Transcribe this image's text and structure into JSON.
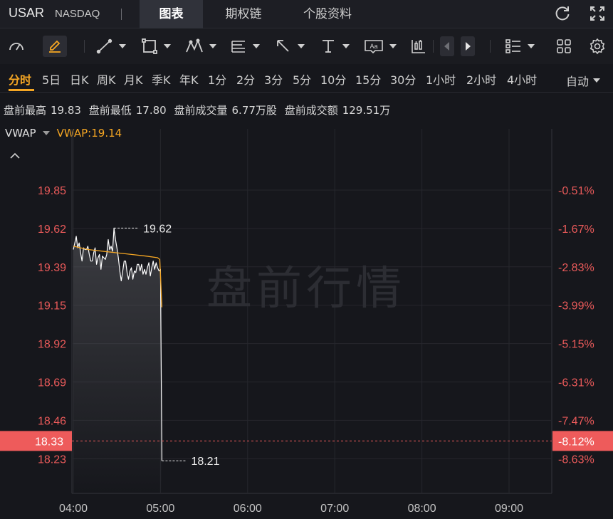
{
  "header": {
    "ticker": "USAR",
    "exchange": "NASDAQ",
    "separator": "|",
    "tabs": [
      {
        "label": "图表",
        "active": true
      },
      {
        "label": "期权链",
        "active": false
      },
      {
        "label": "个股资料",
        "active": false
      }
    ],
    "icons": [
      "refresh-icon",
      "expand-icon"
    ]
  },
  "toolbar": {
    "tools": [
      "indicator-gauge-icon",
      "draw-pencil-icon",
      "line-tool-icon",
      "rectangle-tool-icon",
      "pattern-tool-icon",
      "fibonacci-tool-icon",
      "arrow-tool-icon",
      "text-tool-icon",
      "label-tool-icon",
      "candlestick-tool-icon",
      "prev-arrow-icon",
      "next-arrow-icon",
      "layout-list-icon",
      "grid-icon",
      "settings-icon"
    ]
  },
  "periods": {
    "items": [
      "分时",
      "5日",
      "日K",
      "周K",
      "月K",
      "季K",
      "年K",
      "1分",
      "2分",
      "3分",
      "5分",
      "10分",
      "15分",
      "30分",
      "1小时",
      "2小时",
      "4小时"
    ],
    "active_index": 0,
    "auto_label": "自动"
  },
  "info": {
    "high_label": "盘前最高",
    "high_value": "19.83",
    "low_label": "盘前最低",
    "low_value": "17.80",
    "volume_label": "盘前成交量",
    "volume_value": "6.77万股",
    "turnover_label": "盘前成交额",
    "turnover_value": "129.51万"
  },
  "indicator": {
    "name": "VWAP",
    "value_text": "VWAP:19.14"
  },
  "watermark": "盘前行情",
  "colors": {
    "background": "#16171c",
    "price_line": "#ffffff",
    "vwap_line": "#f5a623",
    "down_red": "#ea5a5a",
    "current_price_badge": "#ee5b5b",
    "grid": "#2a2b31",
    "accent": "#f5a623"
  },
  "chart_data": {
    "type": "line",
    "y_ticks": [
      "19.85",
      "19.62",
      "19.39",
      "19.15",
      "18.92",
      "18.69",
      "18.46",
      "18.23"
    ],
    "y_pct_ticks": [
      "-0.51%",
      "-1.67%",
      "-2.83%",
      "-3.99%",
      "-5.15%",
      "-6.31%",
      "-7.47%",
      "-8.63%"
    ],
    "x_ticks": [
      "04:00",
      "05:00",
      "06:00",
      "07:00",
      "08:00",
      "09:00"
    ],
    "ylim": [
      18.11,
      19.98
    ],
    "xlim_minutes": [
      0,
      322
    ],
    "current_price": "18.33",
    "current_pct": "-8.12%",
    "current_value": 18.33,
    "max_annotation": {
      "label": "19.62",
      "minutes": 28,
      "value": 19.62
    },
    "min_annotation": {
      "label": "18.21",
      "minutes": 61,
      "value": 18.21
    },
    "price_series": {
      "minutes": [
        0,
        2,
        3,
        4,
        5,
        6,
        7,
        8,
        9,
        10,
        11,
        12,
        13,
        14,
        15,
        16,
        17,
        18,
        19,
        20,
        21,
        22,
        23,
        24,
        25,
        26,
        27,
        28,
        29,
        30,
        31,
        32,
        33,
        34,
        35,
        36,
        37,
        38,
        39,
        40,
        41,
        42,
        43,
        44,
        45,
        46,
        47,
        48,
        49,
        50,
        51,
        52,
        53,
        54,
        55,
        56,
        57,
        58,
        59,
        60,
        61
      ],
      "values": [
        19.49,
        19.57,
        19.5,
        19.53,
        19.47,
        19.42,
        19.5,
        19.49,
        19.49,
        19.51,
        19.46,
        19.42,
        19.42,
        19.47,
        19.5,
        19.4,
        19.44,
        19.46,
        19.37,
        19.45,
        19.44,
        19.43,
        19.46,
        19.55,
        19.49,
        19.51,
        19.48,
        19.62,
        19.55,
        19.5,
        19.44,
        19.36,
        19.3,
        19.36,
        19.42,
        19.42,
        19.35,
        19.31,
        19.36,
        19.38,
        19.31,
        19.36,
        19.35,
        19.4,
        19.4,
        19.36,
        19.4,
        19.34,
        19.37,
        19.34,
        19.38,
        19.41,
        19.33,
        19.38,
        19.42,
        19.37,
        19.41,
        19.38,
        19.36,
        19.37,
        18.21
      ]
    },
    "vwap_series": {
      "minutes": [
        0,
        5,
        10,
        20,
        30,
        40,
        50,
        58,
        59.5,
        61
      ],
      "values": [
        19.51,
        19.5,
        19.49,
        19.48,
        19.47,
        19.46,
        19.45,
        19.44,
        19.43,
        19.14
      ]
    }
  }
}
